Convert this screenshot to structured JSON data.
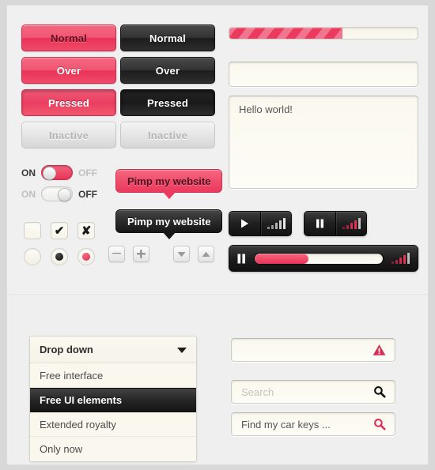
{
  "buttons": {
    "pink": [
      {
        "label": "Normal",
        "state": "normal"
      },
      {
        "label": "Over",
        "state": "over"
      },
      {
        "label": "Pressed",
        "state": "pressed"
      },
      {
        "label": "Inactive",
        "state": "inactive"
      }
    ],
    "dark": [
      {
        "label": "Normal",
        "state": "normal"
      },
      {
        "label": "Over",
        "state": "over"
      },
      {
        "label": "Pressed",
        "state": "pressed"
      },
      {
        "label": "Inactive",
        "state": "inactive"
      }
    ]
  },
  "toggles": [
    {
      "on_label": "ON",
      "off_label": "OFF",
      "state": "on"
    },
    {
      "on_label": "ON",
      "off_label": "OFF",
      "state": "off"
    }
  ],
  "checkboxes": [
    {
      "name": "checkbox-empty",
      "glyph": ""
    },
    {
      "name": "checkbox-checked",
      "glyph": "✔"
    },
    {
      "name": "checkbox-crossed",
      "glyph": "✘"
    }
  ],
  "radios": [
    {
      "name": "radio-empty",
      "fill": "none"
    },
    {
      "name": "radio-selected-dark",
      "fill": "black"
    },
    {
      "name": "radio-selected-pink",
      "fill": "pink"
    }
  ],
  "steppers": [
    {
      "name": "stepper-minus",
      "icon": "minus-icon"
    },
    {
      "name": "stepper-plus",
      "icon": "plus-icon"
    },
    {
      "name": "stepper-down",
      "icon": "chevron-down-icon"
    },
    {
      "name": "stepper-up",
      "icon": "chevron-up-icon"
    }
  ],
  "tooltips": [
    {
      "text": "Pimp my website",
      "style": "pink"
    },
    {
      "text": "Pimp my website",
      "style": "dark"
    }
  ],
  "progress": {
    "percent": 60,
    "label": ""
  },
  "text_input": {
    "value": "",
    "placeholder": ""
  },
  "textarea": {
    "value": "Hello world!",
    "placeholder": ""
  },
  "media": {
    "play_group": {
      "play_icon": "play-icon",
      "level_icon": "signal-bars-icon",
      "level_color": "#c8c8c8"
    },
    "pause_group": {
      "pause_icon": "pause-icon",
      "level_icon": "signal-bars-icon",
      "level_color": "#ea3258"
    }
  },
  "player": {
    "state_icon": "pause-icon",
    "percent": 42,
    "level_icon": "signal-bars-icon"
  },
  "dropdown": {
    "header": "Drop down",
    "items": [
      {
        "label": "Free interface",
        "selected": false
      },
      {
        "label": "Free UI elements",
        "selected": true
      },
      {
        "label": "Extended royalty",
        "selected": false
      },
      {
        "label": "Only now",
        "selected": false
      }
    ]
  },
  "search_fields": [
    {
      "name": "error-field",
      "value": "",
      "placeholder": "",
      "icon": "warning-icon"
    },
    {
      "name": "search-field",
      "value": "",
      "placeholder": "Search",
      "icon": "search-icon"
    },
    {
      "name": "find-field",
      "value": "Find my car keys ...",
      "placeholder": "",
      "icon": "search-icon"
    }
  ],
  "colors": {
    "accent_pink": "#ea3258",
    "accent_pink_light": "#f4687f",
    "dark": "#1f1f1f",
    "panel_bg": "#f0f0f0",
    "field_bg": "#faf8ee"
  }
}
